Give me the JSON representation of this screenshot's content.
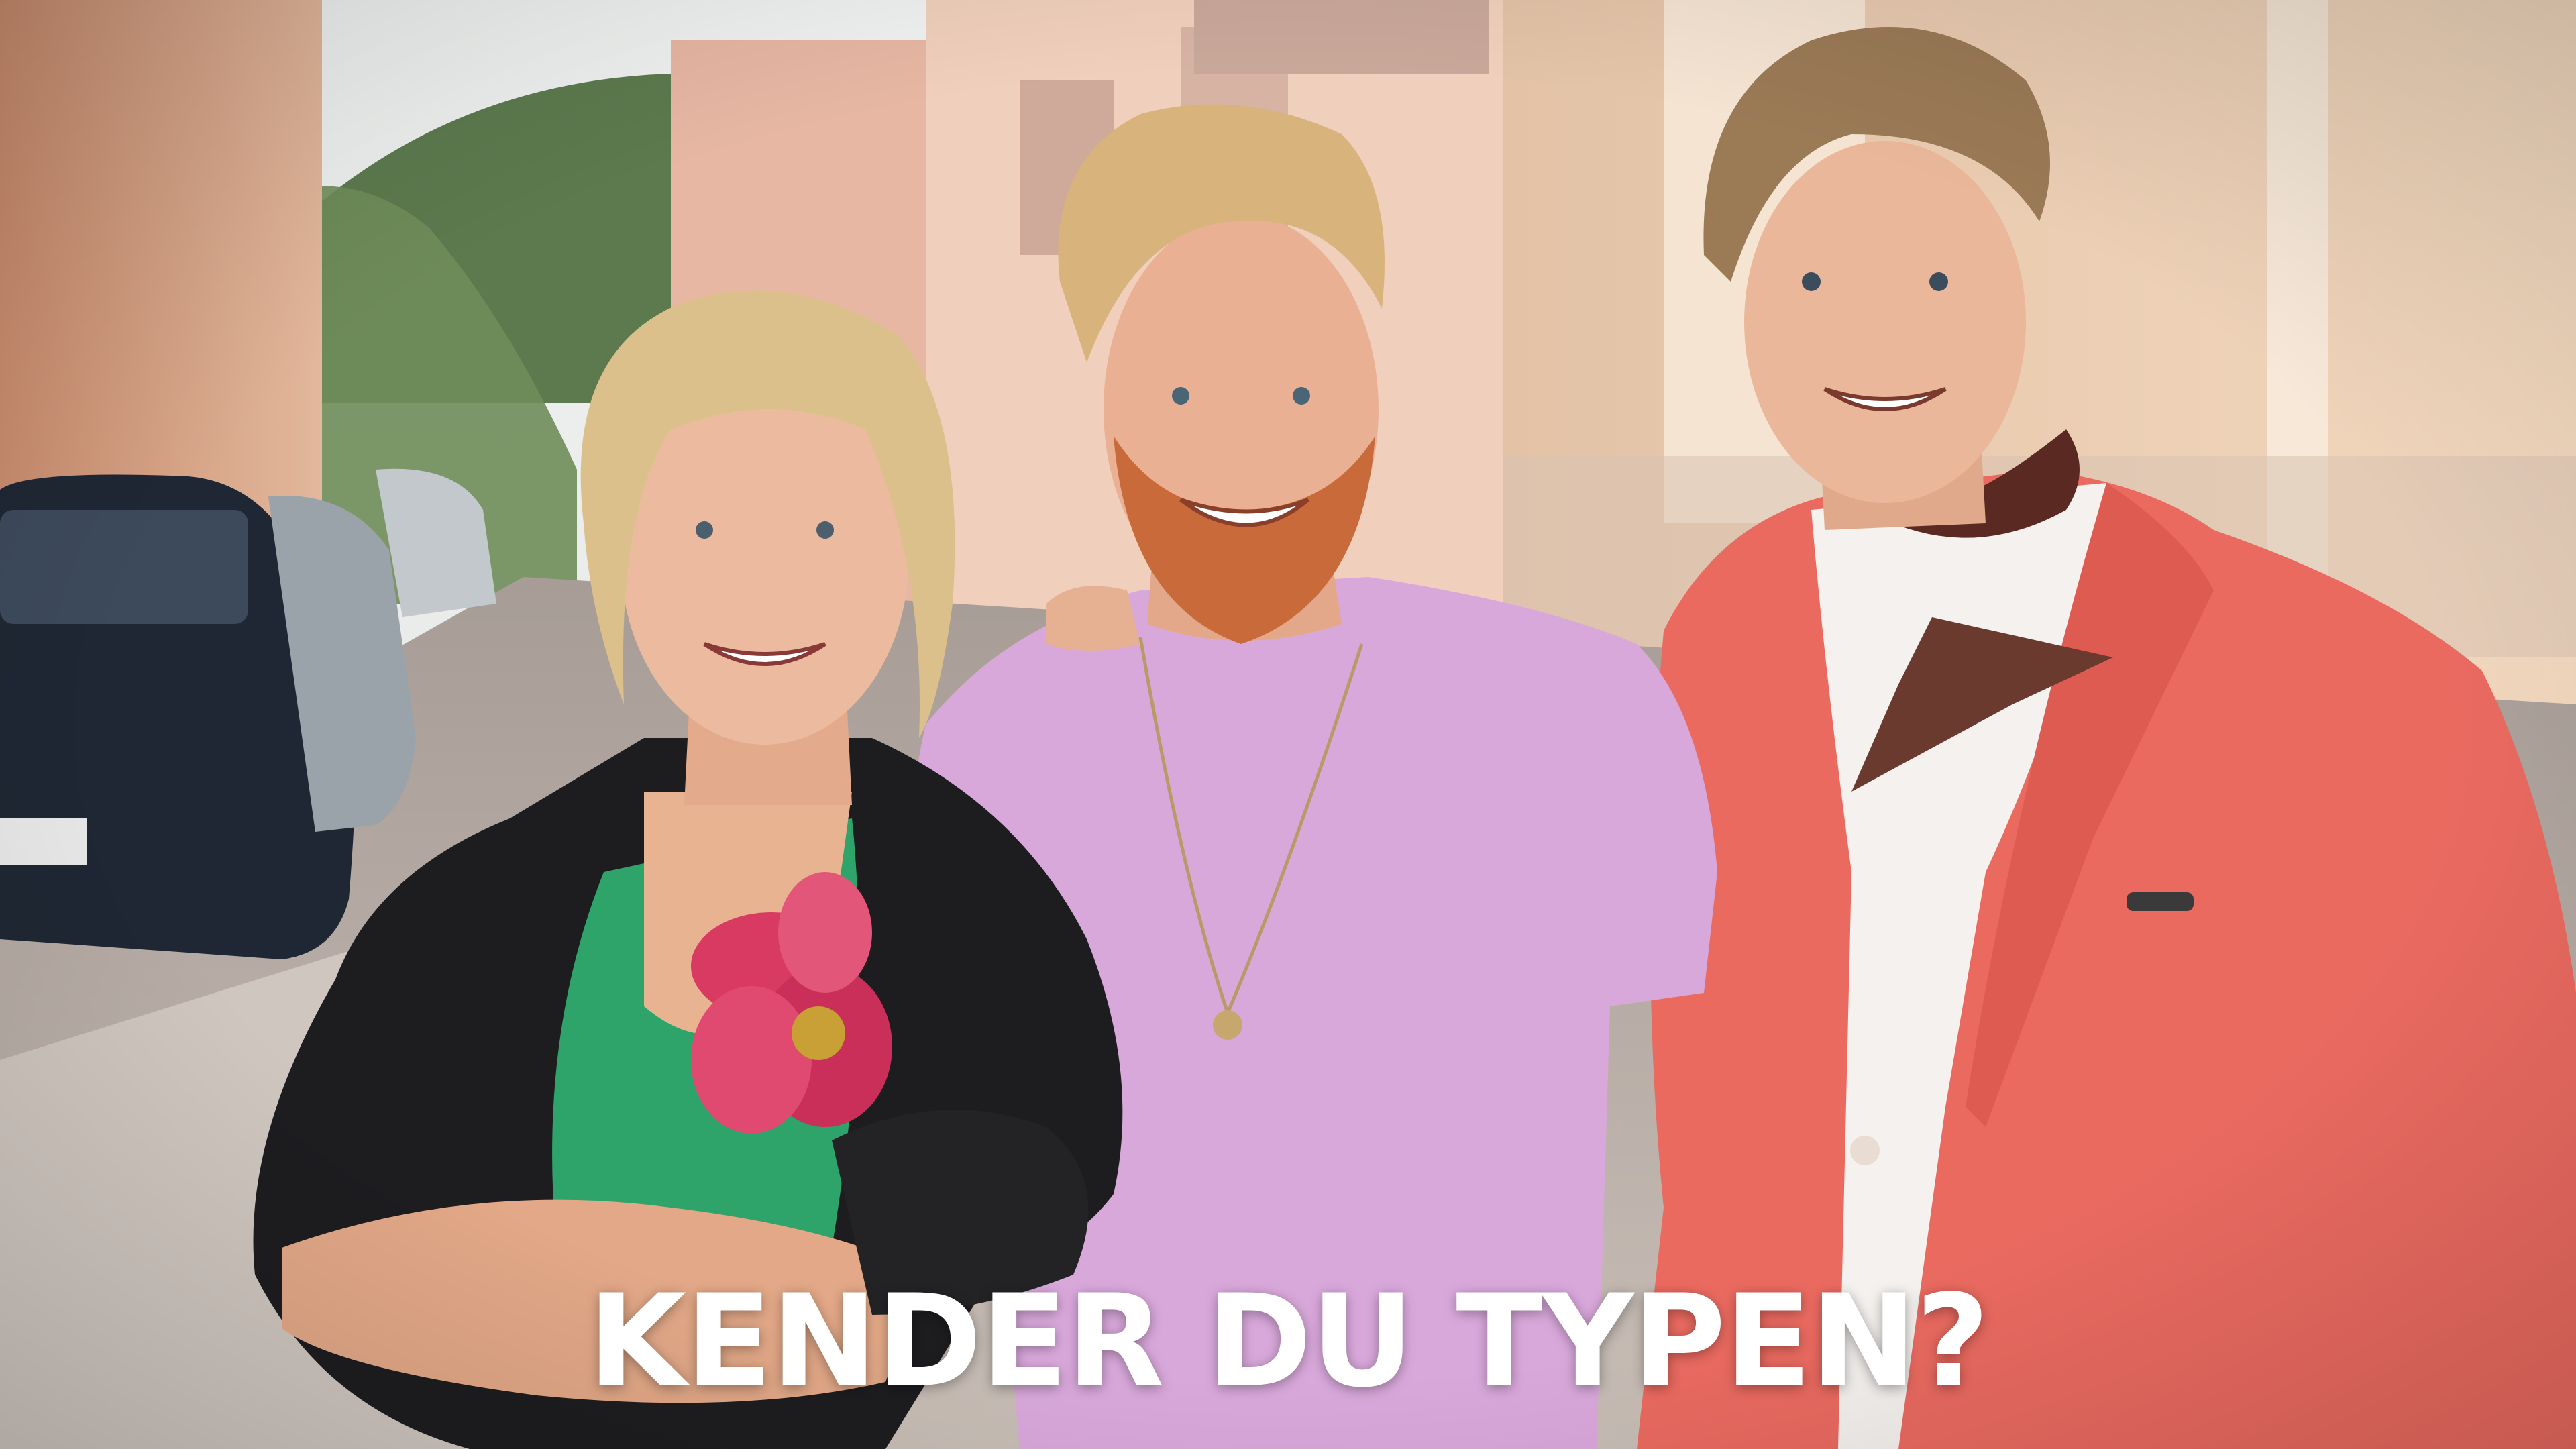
{
  "title": {
    "text": "KENDER DU TYPEN?"
  },
  "colors": {
    "sky": "#e9ecea",
    "hill": "#5c7a4e",
    "building_left": "#d9a488",
    "building_right": "#efd2b6",
    "street": "#b9aea6",
    "car": "#1f2734",
    "jacket_left": "#1d1d20",
    "top_green": "#2ea36a",
    "flower": "#d83a62",
    "tshirt": "#d9a8db",
    "blazer": "#ea6a60",
    "shirt": "#f4f1ee",
    "skin": "#e8b89a",
    "hair_blond": "#d8b47c",
    "beard": "#c86a3a",
    "hair_brown": "#9b7a56",
    "title_text": "#ffffff"
  }
}
